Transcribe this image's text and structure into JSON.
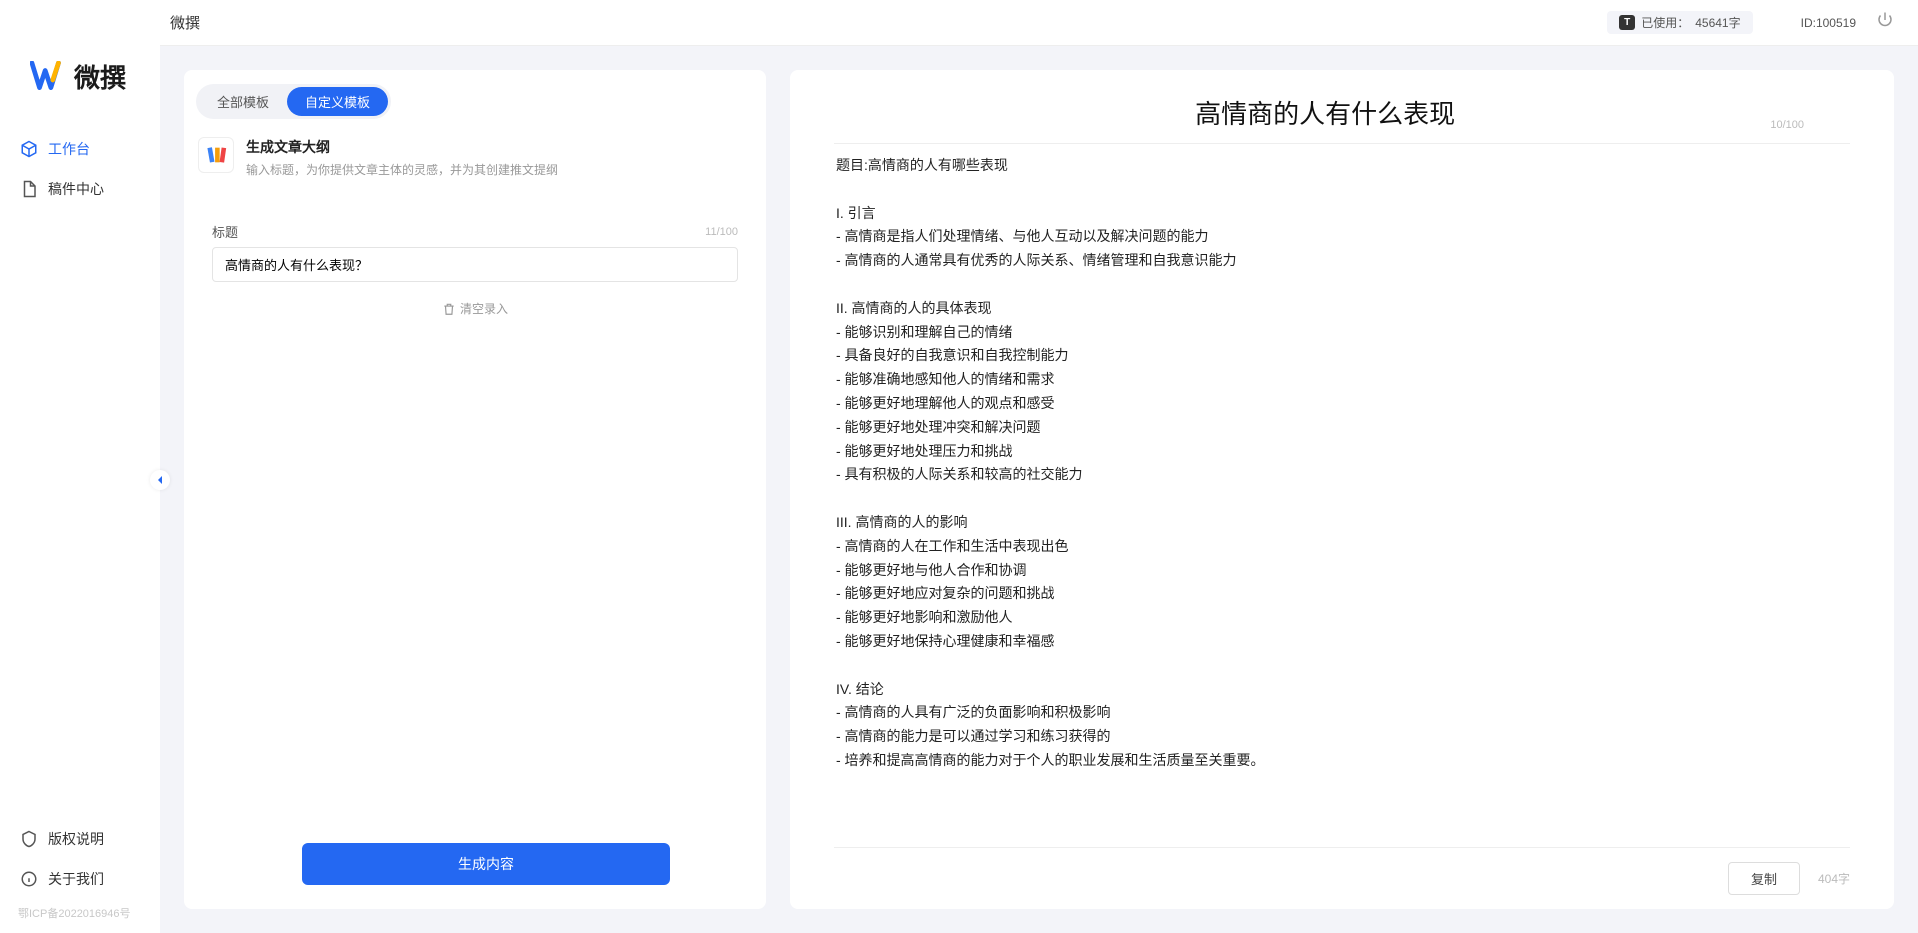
{
  "app": {
    "name": "微撰",
    "top_title": "微撰"
  },
  "header": {
    "usage_label": "已使用：",
    "usage_value": "45641字",
    "id_label": "ID:",
    "id_value": "100519"
  },
  "nav": {
    "workbench": "工作台",
    "drafts": "稿件中心"
  },
  "sidebar_bottom": {
    "copyright": "版权说明",
    "about": "关于我们",
    "icp": "鄂ICP备2022016946号"
  },
  "left_panel": {
    "tabs": {
      "all": "全部模板",
      "custom": "自定义模板"
    },
    "template": {
      "name": "生成文章大纲",
      "desc": "输入标题，为你提供文章主体的灵感，并为其创建推文提纲"
    },
    "form": {
      "title_label": "标题",
      "title_counter": "11/100",
      "title_value": "高情商的人有什么表现？",
      "clear_label": "清空录入"
    },
    "generate_label": "生成内容"
  },
  "right_panel": {
    "title": "高情商的人有什么表现",
    "title_counter": "10/100",
    "body": "题目:高情商的人有哪些表现\n\nI. 引言\n- 高情商是指人们处理情绪、与他人互动以及解决问题的能力\n- 高情商的人通常具有优秀的人际关系、情绪管理和自我意识能力\n\nII. 高情商的人的具体表现\n- 能够识别和理解自己的情绪\n- 具备良好的自我意识和自我控制能力\n- 能够准确地感知他人的情绪和需求\n- 能够更好地理解他人的观点和感受\n- 能够更好地处理冲突和解决问题\n- 能够更好地处理压力和挑战\n- 具有积极的人际关系和较高的社交能力\n\nIII. 高情商的人的影响\n- 高情商的人在工作和生活中表现出色\n- 能够更好地与他人合作和协调\n- 能够更好地应对复杂的问题和挑战\n- 能够更好地影响和激励他人\n- 能够更好地保持心理健康和幸福感\n\nIV. 结论\n- 高情商的人具有广泛的负面影响和积极影响\n- 高情商的能力是可以通过学习和练习获得的\n- 培养和提高高情商的能力对于个人的职业发展和生活质量至关重要。",
    "copy_label": "复制",
    "word_count": "404字"
  }
}
